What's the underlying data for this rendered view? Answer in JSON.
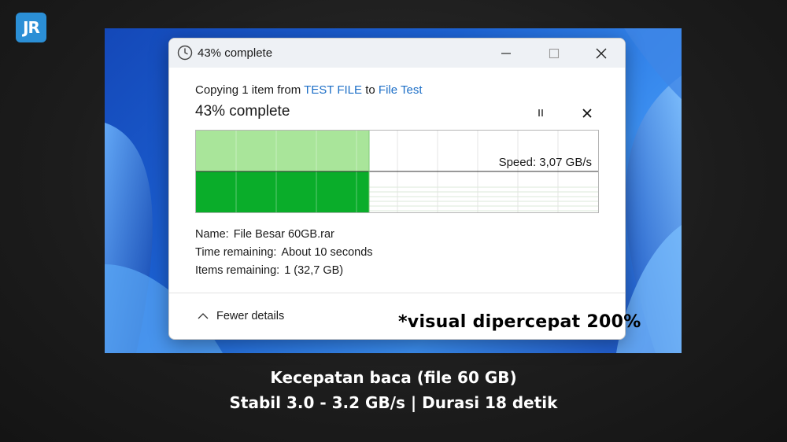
{
  "logo": {
    "text": "JR"
  },
  "window": {
    "title": "43% complete",
    "title_icon": "clock-icon",
    "controls": {
      "minimize": "minimize-icon",
      "maximize": "maximize-icon",
      "close": "close-icon"
    }
  },
  "copy": {
    "prefix": "Copying 1 item from",
    "source": "TEST FILE",
    "connector": "to",
    "destination": "File Test"
  },
  "progress": {
    "label": "43% complete",
    "fraction": 0.43,
    "pause_icon": "pause-icon",
    "cancel_icon": "close-icon"
  },
  "speed": {
    "label": "Speed: 3,07 GB/s"
  },
  "details": {
    "name_label": "Name:",
    "name_value": "File Besar 60GB.rar",
    "time_label": "Time remaining:",
    "time_value": "About 10 seconds",
    "items_label": "Items remaining:",
    "items_value": "1 (32,7 GB)"
  },
  "footer": {
    "fewer_details": "Fewer details",
    "chevron_icon": "chevron-up-icon"
  },
  "overlay_note": "*visual dipercepat 200%",
  "caption": {
    "line1": "Kecepatan baca (file 60 GB)",
    "line2": "Stabil 3.0 - 3.2 GB/s | Durasi 18 detik"
  },
  "colors": {
    "graph_fill": "#0aad2a",
    "graph_fill_light": "#a9e59a",
    "link": "#1d6fc7"
  }
}
